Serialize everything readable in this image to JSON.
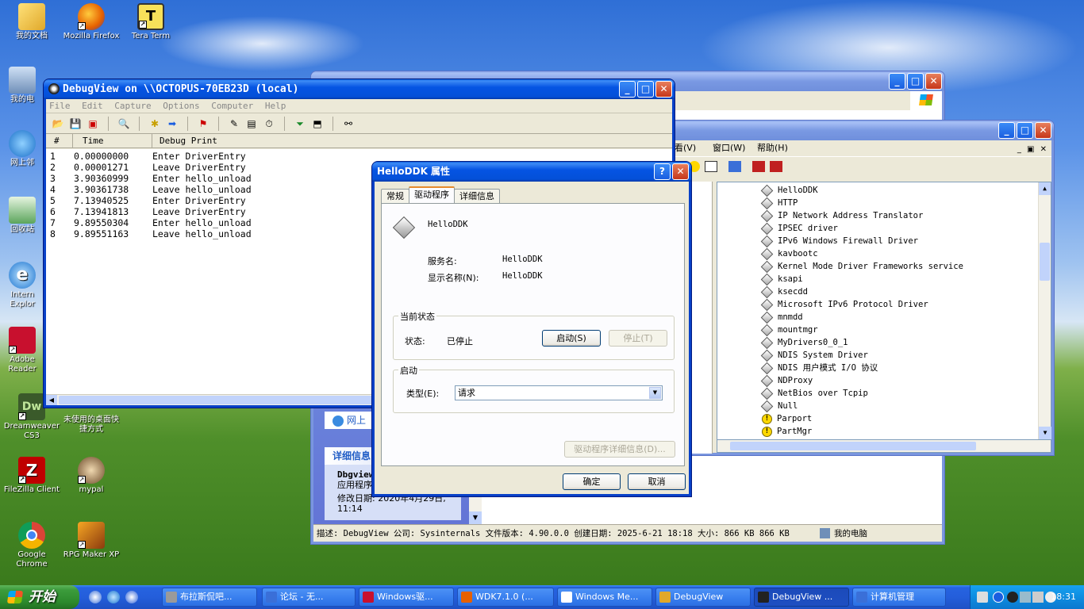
{
  "desktop": {
    "icons": [
      {
        "label": "我的文档",
        "icon": "folder-icon"
      },
      {
        "label": "Mozilla Firefox",
        "icon": "firefox-icon"
      },
      {
        "label": "Tera Term",
        "icon": "tera-term-icon"
      },
      {
        "label": "我的电",
        "icon": "computer-icon"
      },
      {
        "label": "网上邻",
        "icon": "network-icon"
      },
      {
        "label": "回收站",
        "icon": "recycle-bin-icon"
      },
      {
        "label": "Intern Explor",
        "icon": "ie-icon"
      },
      {
        "label": "Adobe Reader",
        "icon": "adobe-reader-icon"
      },
      {
        "label": "Dreamweaver CS3",
        "icon": "dreamweaver-icon"
      },
      {
        "label": "未使用的桌面快捷方式",
        "icon": "folder-icon"
      },
      {
        "label": "FileZilla Client",
        "icon": "filezilla-icon"
      },
      {
        "label": "mypal",
        "icon": "mypal-icon"
      },
      {
        "label": "Google Chrome",
        "icon": "chrome-icon"
      },
      {
        "label": "RPG Maker XP",
        "icon": "rpg-maker-icon"
      }
    ]
  },
  "debugview": {
    "title": "DebugView on \\\\OCTOPUS-70EB23D (local)",
    "menu": [
      "File",
      "Edit",
      "Capture",
      "Options",
      "Computer",
      "Help"
    ],
    "columns": [
      "#",
      "Time",
      "Debug Print"
    ],
    "rows": [
      {
        "n": "1",
        "time": "0.00000000",
        "msg": "Enter DriverEntry"
      },
      {
        "n": "2",
        "time": "0.00001271",
        "msg": "Leave DriverEntry"
      },
      {
        "n": "3",
        "time": "3.90360999",
        "msg": "Enter hello_unload"
      },
      {
        "n": "4",
        "time": "3.90361738",
        "msg": "Leave hello_unload"
      },
      {
        "n": "5",
        "time": "7.13940525",
        "msg": "Enter DriverEntry"
      },
      {
        "n": "6",
        "time": "7.13941813",
        "msg": "Leave DriverEntry"
      },
      {
        "n": "7",
        "time": "9.89550304",
        "msg": "Enter hello_unload"
      },
      {
        "n": "8",
        "time": "9.89551163",
        "msg": "Leave hello_unload"
      }
    ]
  },
  "devmgr": {
    "menu_visible": [
      "看(V)",
      "窗口(W)",
      "帮助(H)"
    ],
    "items": [
      {
        "label": "HelloDDK",
        "warn": false
      },
      {
        "label": "HTTP",
        "warn": false
      },
      {
        "label": "IP Network Address Translator",
        "warn": false
      },
      {
        "label": "IPSEC driver",
        "warn": false
      },
      {
        "label": "IPv6 Windows Firewall Driver",
        "warn": false
      },
      {
        "label": "kavbootc",
        "warn": false
      },
      {
        "label": "Kernel Mode Driver Frameworks service",
        "warn": false
      },
      {
        "label": "ksapi",
        "warn": false
      },
      {
        "label": "ksecdd",
        "warn": false
      },
      {
        "label": "Microsoft IPv6 Protocol Driver",
        "warn": false
      },
      {
        "label": "mnmdd",
        "warn": false
      },
      {
        "label": "mountmgr",
        "warn": false
      },
      {
        "label": "MyDrivers0_0_1",
        "warn": false
      },
      {
        "label": "NDIS System Driver",
        "warn": false
      },
      {
        "label": "NDIS 用户模式 I/O 协议",
        "warn": false
      },
      {
        "label": "NDProxy",
        "warn": false
      },
      {
        "label": "NetBios over Tcpip",
        "warn": false
      },
      {
        "label": "Null",
        "warn": false
      },
      {
        "label": "Parport",
        "warn": true
      },
      {
        "label": "PartMgr",
        "warn": true
      }
    ]
  },
  "explorer": {
    "network_label": "网上",
    "details_header": "详细信息",
    "file_name": "Dbgview",
    "file_type": "应用程序",
    "modified": "修改日期: 2020年4月29日, 11:14",
    "statusbar": "描述: DebugView 公司: Sysinternals 文件版本: 4.90.0.0 创建日期: 2025-6-21 18:18 大小: 866 KB 866 KB",
    "status_location": "我的电脑"
  },
  "dialog": {
    "title": "HelloDDK 属性",
    "tabs": [
      "常规",
      "驱动程序",
      "详细信息"
    ],
    "driver_name": "HelloDDK",
    "service_name_label": "服务名:",
    "service_name": "HelloDDK",
    "display_name_label": "显示名称(N):",
    "display_name": "HelloDDK",
    "current_status_group": "当前状态",
    "status_label": "状态:",
    "status_value": "已停止",
    "start_button": "启动(S)",
    "stop_button": "停止(T)",
    "startup_group": "启动",
    "type_label": "类型(E):",
    "type_value": "请求",
    "details_button": "驱动程序详细信息(D)...",
    "ok_button": "确定",
    "cancel_button": "取消"
  },
  "taskbar": {
    "start_label": "开始",
    "tasks": [
      {
        "label": "布拉斯侃吧...",
        "active": false
      },
      {
        "label": "论坛 - 无...",
        "active": false
      },
      {
        "label": "Windows驱...",
        "active": false
      },
      {
        "label": "WDK7.1.0 (...",
        "active": false
      },
      {
        "label": "Windows Me...",
        "active": false
      },
      {
        "label": "DebugView",
        "active": false
      },
      {
        "label": "DebugView ...",
        "active": true
      },
      {
        "label": "计算机管理",
        "active": false
      }
    ],
    "clock": "18:31"
  }
}
